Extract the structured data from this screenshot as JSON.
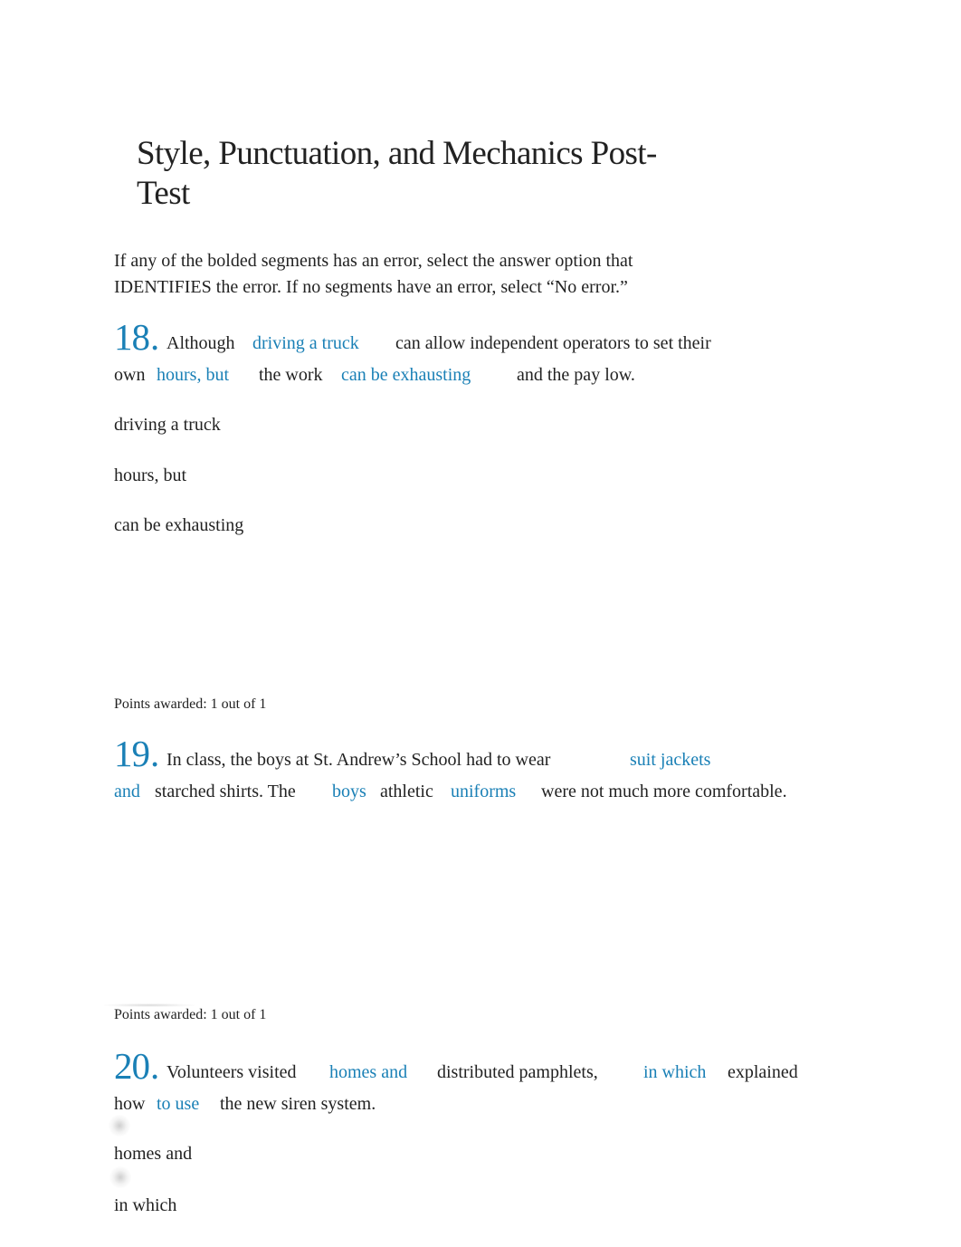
{
  "page": {
    "title": "Style, Punctuation, and Mechanics Post-Test",
    "title_line1": "Style, Punctuation, and Mechanics Post-",
    "title_line2": "Test",
    "instructions": "If any of the bolded segments has an error, select the answer option that IDENTIFIES the error. If no segments have an error, select “No error.”",
    "accent_color": "#1a80b6",
    "text_color": "#222222"
  },
  "questions": [
    {
      "number": "18",
      "dot": ".",
      "line1": {
        "t1": "Although",
        "s1": "driving a truck",
        "t2": "can allow independent operators to set their"
      },
      "line2": {
        "t1": "own",
        "s1": "hours, but",
        "t2": "the work",
        "s2": "can be exhausting",
        "t3": "and the pay low."
      },
      "options": [
        "driving a truck",
        "hours, but",
        "can be exhausting"
      ],
      "points": "Points awarded: 1 out of 1"
    },
    {
      "number": "19",
      "dot": ".",
      "line1": {
        "t1": "In class, the boys at St. Andrew’s School had to wear",
        "s1": "suit jackets"
      },
      "line2": {
        "s1": "and",
        "t1": "starched shirts. The",
        "s2": "boys",
        "t2": "athletic",
        "s3": "uniforms",
        "t3": "were not much more comfortable."
      },
      "options": [],
      "points": "Points awarded: 1 out of 1"
    },
    {
      "number": "20",
      "dot": ".",
      "line1": {
        "t1": "Volunteers visited",
        "s1": "homes and",
        "t2": "distributed pamphlets,",
        "s2": "in which",
        "t3": "explained"
      },
      "line2": {
        "t1": "how",
        "s1": "to use",
        "t2": "the new siren system."
      },
      "options": [
        "homes and",
        "in which"
      ]
    }
  ]
}
